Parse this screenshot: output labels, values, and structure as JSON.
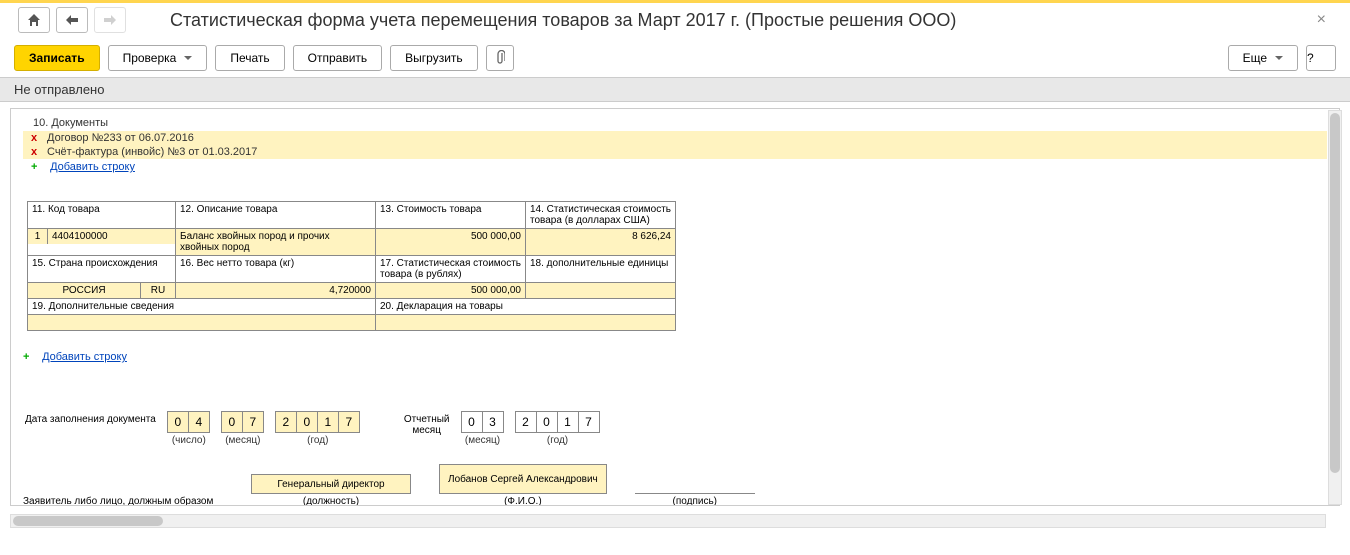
{
  "title": "Статистическая форма учета перемещения товаров за Март 2017 г. (Простые решения ООО)",
  "toolbar": {
    "save": "Записать",
    "check": "Проверка",
    "print": "Печать",
    "send": "Отправить",
    "export": "Выгрузить",
    "more": "Еще",
    "help": "?"
  },
  "status": "Не отправлено",
  "docs": {
    "heading": "10. Документы",
    "rows": [
      "Договор №233 от 06.07.2016",
      "Счёт-фактура (инвойс) №3 от 01.03.2017"
    ],
    "add": "Добавить строку"
  },
  "goods": {
    "h11": "11. Код товара",
    "h12": "12. Описание товара",
    "h13": "13. Стоимость товара",
    "h14": "14. Статистическая стоимость товара (в долларах США)",
    "h15": "15. Страна происхождения",
    "h16": "16. Вес нетто товара (кг)",
    "h17": "17. Статистическая стоимость товара (в рублях)",
    "h18": "18. дополнительные единицы",
    "h19": "19. Дополнительные сведения",
    "h20": "20. Декларация на товары",
    "row_num": "1",
    "code": "4404100000",
    "desc": "Баланс хвойных пород и прочих хвойных пород",
    "cost": "500 000,00",
    "stat_usd": "8 626,24",
    "country": "РОССИЯ",
    "country_code": "RU",
    "weight": "4,720000",
    "stat_rub": "500 000,00",
    "units": "",
    "extra": "",
    "decl": ""
  },
  "add_row": "Добавить строку",
  "dates": {
    "fill_label": "Дата заполнения документа",
    "day": [
      "0",
      "4"
    ],
    "month": [
      "0",
      "7"
    ],
    "year": [
      "2",
      "0",
      "1",
      "7"
    ],
    "day_sub": "(число)",
    "month_sub": "(месяц)",
    "year_sub": "(год)",
    "rep_label1": "Отчетный",
    "rep_label2": "месяц",
    "rep_month": [
      "0",
      "3"
    ],
    "rep_year": [
      "2",
      "0",
      "1",
      "7"
    ],
    "rep_month_sub": "(месяц)",
    "rep_year_sub": "(год)"
  },
  "signer": {
    "left_label": "Заявитель либо лицо, должным образом",
    "position": "Генеральный директор",
    "position_sub": "(должность)",
    "fio": "Лобанов Сергей Александрович",
    "fio_sub": "(Ф.И.О.)",
    "sign_sub": "(подпись)"
  }
}
